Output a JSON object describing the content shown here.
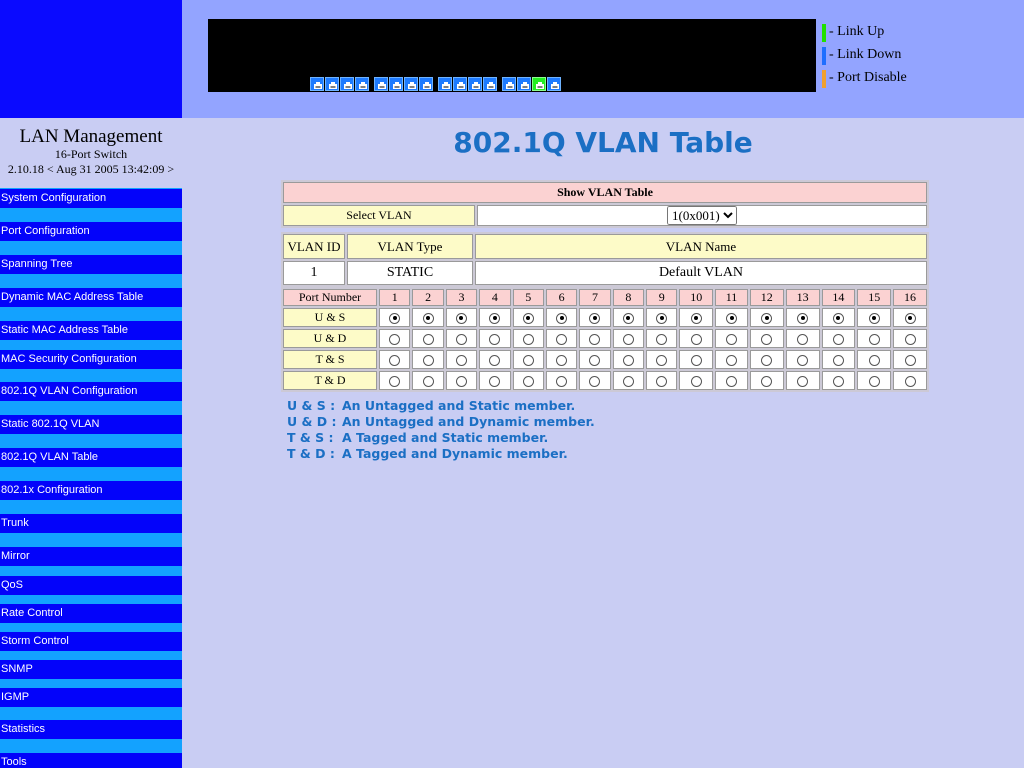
{
  "sidebar": {
    "title": "LAN Management",
    "subtitle": "16-Port Switch",
    "version": "2.10.18 < Aug 31 2005 13:42:09 >",
    "items": [
      {
        "label": "System Configuration"
      },
      {
        "label": "Port Configuration"
      },
      {
        "label": "Spanning Tree"
      },
      {
        "label": "Dynamic MAC Address Table"
      },
      {
        "label": "Static MAC Address Table"
      },
      {
        "label": "MAC Security Configuration"
      },
      {
        "label": "802.1Q VLAN Configuration"
      },
      {
        "label": "Static 802.1Q VLAN"
      },
      {
        "label": "802.1Q VLAN Table"
      },
      {
        "label": "802.1x Configuration"
      },
      {
        "label": "Trunk"
      },
      {
        "label": "Mirror"
      },
      {
        "label": "QoS"
      },
      {
        "label": "Rate Control"
      },
      {
        "label": "Storm Control"
      },
      {
        "label": "SNMP"
      },
      {
        "label": "IGMP"
      },
      {
        "label": "Statistics"
      },
      {
        "label": "Tools"
      }
    ]
  },
  "port_panel": {
    "ports": [
      "down",
      "down",
      "down",
      "down",
      "down",
      "down",
      "down",
      "down",
      "down",
      "down",
      "down",
      "down",
      "down",
      "down",
      "up",
      "down"
    ]
  },
  "legend": {
    "items": [
      {
        "label": "- Link Up",
        "color": "#22e000"
      },
      {
        "label": "- Link Down",
        "color": "#1e6eff"
      },
      {
        "label": "- Port Disable",
        "color": "#f0a030"
      }
    ]
  },
  "main": {
    "title": "802.1Q VLAN Table",
    "show_table": {
      "header": "Show VLAN Table",
      "select_label": "Select VLAN",
      "select_value": "1(0x001)"
    },
    "vlan_info": {
      "headers": [
        "VLAN ID",
        "VLAN Type",
        "VLAN Name"
      ],
      "id": "1",
      "type": "STATIC",
      "name": "Default VLAN"
    },
    "membership": {
      "port_header": "Port Number",
      "ports": [
        "1",
        "2",
        "3",
        "4",
        "5",
        "6",
        "7",
        "8",
        "9",
        "10",
        "11",
        "12",
        "13",
        "14",
        "15",
        "16"
      ],
      "rows": [
        {
          "label": "U & S",
          "checked": true
        },
        {
          "label": "U & D",
          "checked": false
        },
        {
          "label": "T & S",
          "checked": false
        },
        {
          "label": "T & D",
          "checked": false
        }
      ]
    },
    "notes": [
      {
        "key": "U & S :",
        "text": "An Untagged and Static member."
      },
      {
        "key": "U & D :",
        "text": "An Untagged and Dynamic member."
      },
      {
        "key": "T & S :",
        "text": "A Tagged and Static member."
      },
      {
        "key": "T & D :",
        "text": "A Tagged and Dynamic member."
      }
    ]
  }
}
